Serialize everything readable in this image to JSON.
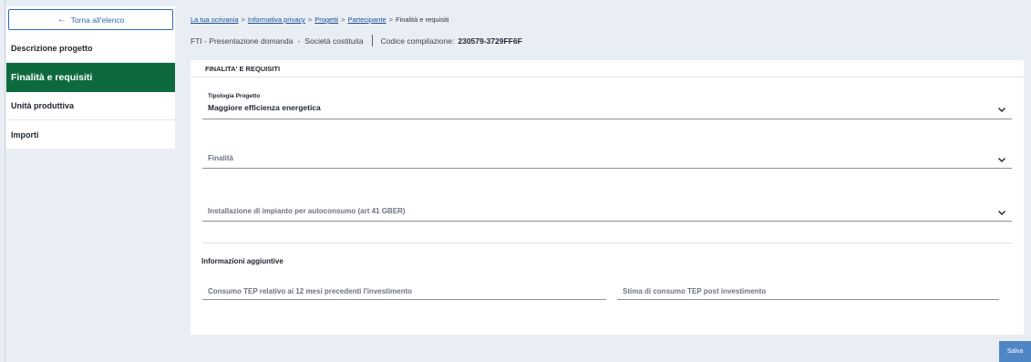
{
  "sidebar": {
    "back_label": "Torna all'elenco",
    "items": [
      {
        "label": "Descrizione progetto",
        "active": false
      },
      {
        "label": "Finalità e requisiti",
        "active": true
      },
      {
        "label": "Unità produttiva",
        "active": false
      },
      {
        "label": "Importi",
        "active": false
      }
    ]
  },
  "breadcrumb": {
    "items": [
      "La tua scrivania",
      "Informativa privacy",
      "Progetti",
      "Partecipante",
      "Finalità e requisiti"
    ],
    "separator": ">"
  },
  "subheader": {
    "procedure": "FTI - Presentazione domanda",
    "dash": "-",
    "company_type": "Società costituita",
    "code_label": "Codice compilazione:",
    "code_value": "230579-3729FF6F"
  },
  "form": {
    "title": "FINALITA' E REQUISITI",
    "tipologia": {
      "label": "Tipologia Progetto",
      "value": "Maggiore efficienza energetica"
    },
    "finalita": {
      "placeholder": "Finalità"
    },
    "installazione": {
      "placeholder": "Installazione di impianto per autoconsumo (art 41 GBER)"
    },
    "info": {
      "title": "Informazioni aggiuntive",
      "consumo_pre_placeholder": "Consumo TEP relativo ai 12 mesi precedenti l'investimento",
      "consumo_post_placeholder": "Stima di consumo TEP post investimento"
    }
  },
  "actions": {
    "save_label": "Salva"
  },
  "colors": {
    "active_nav": "#0d6a3d",
    "link": "#1a4f8f",
    "primary_button": "#4f86c6",
    "page_background": "#e9eef5"
  },
  "icons": {
    "back": "arrow-left-icon",
    "select": "chevron-down-icon"
  }
}
